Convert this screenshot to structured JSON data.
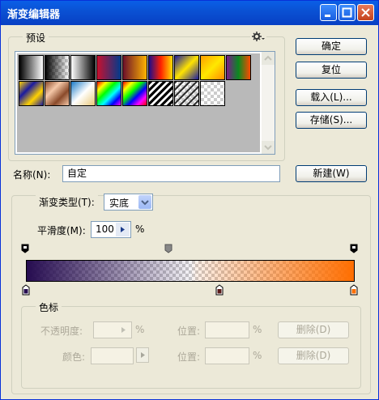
{
  "window": {
    "title": "渐变编辑器"
  },
  "presets": {
    "label": "预设"
  },
  "buttons": {
    "ok": "确定",
    "reset": "复位",
    "load": "载入(L)...",
    "save": "存储(S)...",
    "new": "新建(W)"
  },
  "name_field": {
    "label": "名称(N):",
    "value": "自定"
  },
  "gradient": {
    "type_label": "渐变类型(T):",
    "type_value": "实底",
    "smooth_label": "平滑度(M):",
    "smooth_value": "100",
    "percent": "%"
  },
  "stops_group": {
    "label": "色标",
    "opacity_label": "不透明度:",
    "percent1": "%",
    "position_label1": "位置:",
    "percent2": "%",
    "delete1": "删除(D)",
    "color_label": "颜色:",
    "position_label2": "位置:",
    "percent3": "%",
    "delete2": "删除(D)"
  },
  "colors": {
    "start": "#260c50",
    "end": "#ff6e00",
    "mid": "#5a1a18"
  }
}
